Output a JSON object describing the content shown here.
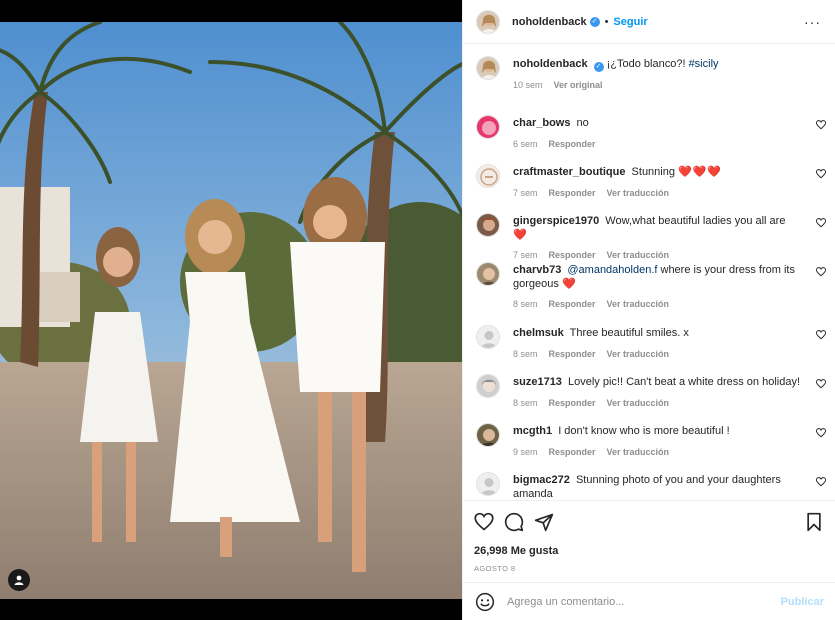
{
  "post": {
    "author": "noholdenback",
    "follow_label": "Seguir",
    "dot": "•",
    "more_label": "···",
    "caption_text": "¡¿Todo blanco?! ",
    "caption_hashtag": "#sicily",
    "caption_time": "10 sem",
    "caption_action": "Ver original"
  },
  "comments": [
    {
      "user": "char_bows",
      "text": "no",
      "hearts": "",
      "time": "6 sem",
      "reply": "Responder",
      "translate": ""
    },
    {
      "user": "craftmaster_boutique",
      "text": "Stunning ",
      "hearts": "❤️❤️❤️",
      "time": "7 sem",
      "reply": "Responder",
      "translate": "Ver traducción"
    },
    {
      "user": "gingerspice1970",
      "text": "Wow,what beautiful ladies you all are ",
      "hearts": "❤️",
      "time": "7 sem",
      "reply": "Responder",
      "translate": "Ver traducción"
    },
    {
      "user": "charvb73",
      "mention": "@amandaholden.f",
      "text": " where is your dress from its gorgeous ",
      "hearts": "❤️",
      "time": "8 sem",
      "reply": "Responder",
      "translate": "Ver traducción"
    },
    {
      "user": "chelmsuk",
      "text": "Three beautiful smiles. x",
      "hearts": "",
      "time": "8 sem",
      "reply": "Responder",
      "translate": "Ver traducción"
    },
    {
      "user": "suze1713",
      "text": "Lovely pic!! Can't beat a white dress on holiday!",
      "hearts": "",
      "time": "8 sem",
      "reply": "Responder",
      "translate": "Ver traducción"
    },
    {
      "user": "mcgth1",
      "text": "I don't know who is more beautiful !",
      "hearts": "",
      "time": "9 sem",
      "reply": "Responder",
      "translate": "Ver traducción"
    },
    {
      "user": "bigmac272",
      "text": "Stunning photo of you and your daughters amanda",
      "hearts": "",
      "time": "",
      "reply": "",
      "translate": ""
    }
  ],
  "footer": {
    "likes": "26,998 Me gusta",
    "date": "AGOSTO 8",
    "comment_placeholder": "Agrega un comentario...",
    "publish_label": "Publicar"
  },
  "colors": {
    "accent": "#0095f6",
    "verified": "#3897f0",
    "heart_red": "#ed4956",
    "muted": "#8e8e8e",
    "publish_disabled": "#b2dffc"
  }
}
